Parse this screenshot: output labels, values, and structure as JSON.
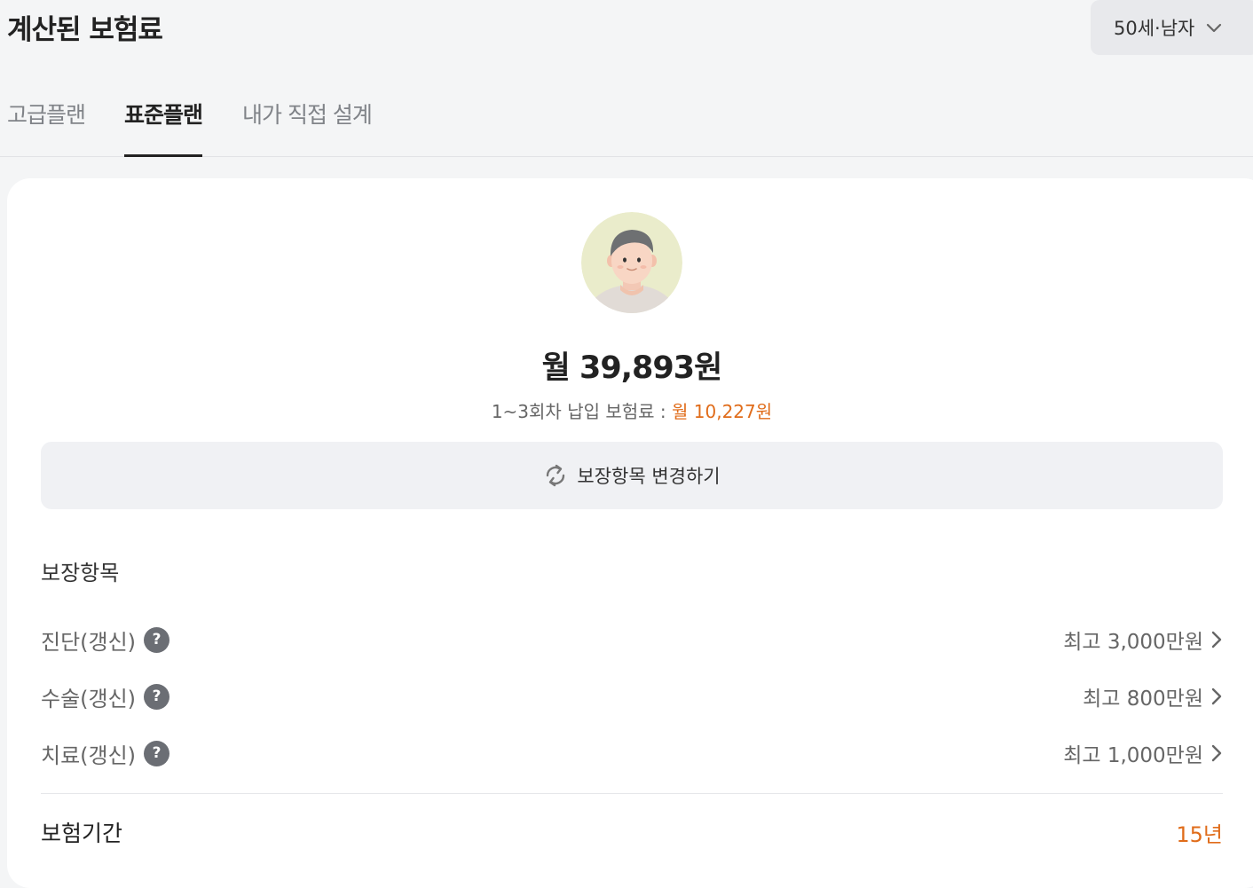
{
  "header": {
    "title": "계산된 보험료",
    "age_gender": "50세·남자"
  },
  "tabs": [
    {
      "label": "고급플랜",
      "active": false
    },
    {
      "label": "표준플랜",
      "active": true
    },
    {
      "label": "내가 직접 설계",
      "active": false
    }
  ],
  "plan": {
    "monthly_premium": "월 39,893원",
    "initial_premium_label": "1~3회차 납입 보험료 : ",
    "initial_premium_value": "월 10,227원",
    "change_button_label": "보장항목 변경하기"
  },
  "coverage": {
    "section_title": "보장항목",
    "items": [
      {
        "name": "진단(갱신)",
        "amount": "최고 3,000만원"
      },
      {
        "name": "수술(갱신)",
        "amount": "최고 800만원"
      },
      {
        "name": "치료(갱신)",
        "amount": "최고 1,000만원"
      }
    ]
  },
  "period": {
    "label": "보험기간",
    "value": "15년"
  },
  "colors": {
    "accent": "#e06c1a",
    "background": "#f4f5f6",
    "card": "#ffffff"
  },
  "icons": {
    "dropdown": "chevron-down-icon",
    "refresh": "refresh-icon",
    "help": "question-icon",
    "detail": "chevron-right-icon"
  }
}
